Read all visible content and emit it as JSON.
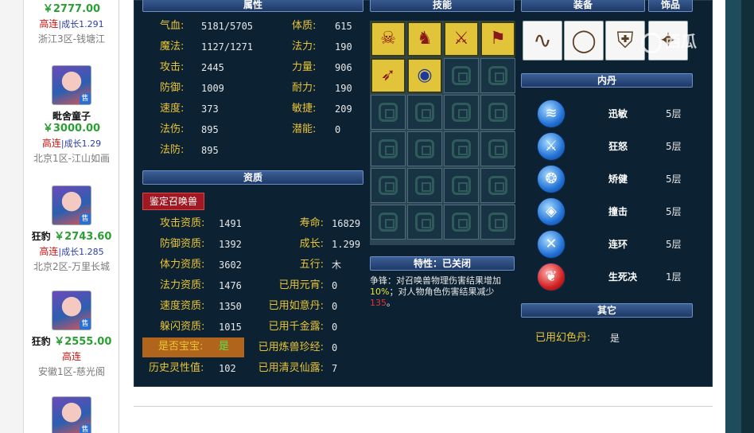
{
  "listings": [
    {
      "price": "￥2777.00",
      "tag": "高连",
      "growth": "|成长1.291",
      "server": "浙江3区-钱塘江"
    },
    {
      "name": "毗舍童子",
      "price": "￥3000.00",
      "tag": "高连",
      "growth": "|成长1.29",
      "server": "北京1区-江山如画",
      "sell": "售"
    },
    {
      "pet": "狂豹",
      "price": "￥2743.60",
      "tag": "高连",
      "growth": "|成长1.285",
      "server": "北京2区-万里长城",
      "sell": "售"
    },
    {
      "pet": "狂豹",
      "price": "￥2555.00",
      "tag": "高连",
      "growth": "",
      "server": "安徽1区-慈光阁",
      "sell": "售"
    },
    {
      "sell": "售"
    }
  ],
  "headers": {
    "attributes": "属性",
    "skills": "技能",
    "equipment": "装备",
    "accessory": "饰品",
    "aptitude": "资质",
    "inner_dan": "内丹",
    "other": "其它"
  },
  "attributes": [
    {
      "label": "气血:",
      "value": "5181/5705"
    },
    {
      "label": "魔法:",
      "value": "1127/1271"
    },
    {
      "label": "攻击:",
      "value": "2445"
    },
    {
      "label": "防御:",
      "value": "1009"
    },
    {
      "label": "速度:",
      "value": "373"
    },
    {
      "label": "法伤:",
      "value": "895"
    },
    {
      "label": "法防:",
      "value": "895"
    }
  ],
  "attributes_right": [
    {
      "label": "体质:",
      "value": "615"
    },
    {
      "label": "法力:",
      "value": "190"
    },
    {
      "label": "力量:",
      "value": "906"
    },
    {
      "label": "耐力:",
      "value": "190"
    },
    {
      "label": "敏捷:",
      "value": "209"
    },
    {
      "label": "潜能:",
      "value": "0"
    }
  ],
  "appraise_button": "鉴定召唤兽",
  "aptitude_left": [
    {
      "label": "攻击资质:",
      "value": "1491"
    },
    {
      "label": "防御资质:",
      "value": "1392"
    },
    {
      "label": "体力资质:",
      "value": "3602"
    },
    {
      "label": "法力资质:",
      "value": "1476"
    },
    {
      "label": "速度资质:",
      "value": "1350"
    },
    {
      "label": "躲闪资质:",
      "value": "1015"
    }
  ],
  "baby": {
    "label": "是否宝宝:",
    "value": "是"
  },
  "history": {
    "label": "历史灵性值:",
    "value": "102"
  },
  "aptitude_right": [
    {
      "label": "寿命:",
      "value": "16829"
    },
    {
      "label": "成长:",
      "value": "1.299"
    },
    {
      "label": "五行:",
      "value": "木"
    },
    {
      "label": "已用元宵:",
      "value": "0"
    },
    {
      "label": "已用如意丹:",
      "value": "0"
    },
    {
      "label": "已用千金露:",
      "value": "0"
    },
    {
      "label": "已用炼兽珍经:",
      "value": "0"
    },
    {
      "label": "已用清灵仙露:",
      "value": "7"
    }
  ],
  "skills": [
    {
      "icon": "skull-skill-icon",
      "glyph": "☠"
    },
    {
      "icon": "beast-skill-icon",
      "glyph": "♞"
    },
    {
      "icon": "sword-skill-icon",
      "glyph": "⚔"
    },
    {
      "icon": "scroll-skill-icon",
      "glyph": "⚑"
    },
    {
      "icon": "bow-skill-icon",
      "glyph": "➶"
    },
    {
      "icon": "eye-skill-icon",
      "glyph": "◉"
    }
  ],
  "trait": {
    "header": "特性：已关闭",
    "line1": "争锋：对召唤兽物理伤害结果增加",
    "pct": "10%",
    "line2": "；对人物角色伤害结果减少",
    "num": "135",
    "tail": "。"
  },
  "equipment": [
    {
      "icon": "necklace-icon",
      "glyph": "∿"
    },
    {
      "icon": "ring-icon",
      "glyph": "◯"
    },
    {
      "icon": "armor-icon",
      "glyph": "⛨"
    },
    {
      "icon": "ornament-icon",
      "glyph": "✦"
    }
  ],
  "inner_dan": [
    {
      "name": "迅敏",
      "level": "5层",
      "icon": "swift-dan-icon",
      "glyph": "≋"
    },
    {
      "name": "狂怒",
      "level": "5层",
      "icon": "rage-dan-icon",
      "glyph": "⚔"
    },
    {
      "name": "矫健",
      "level": "5层",
      "icon": "agile-dan-icon",
      "glyph": "❂"
    },
    {
      "name": "撞击",
      "level": "5层",
      "icon": "strike-dan-icon",
      "glyph": "◈"
    },
    {
      "name": "连环",
      "level": "5层",
      "icon": "combo-dan-icon",
      "glyph": "✕"
    },
    {
      "name": "生死决",
      "level": "1层",
      "icon": "life-death-dan-icon",
      "glyph": "❦"
    }
  ],
  "other": {
    "label": "已用幻色丹:",
    "value": "是"
  },
  "watermark": "西瓜"
}
